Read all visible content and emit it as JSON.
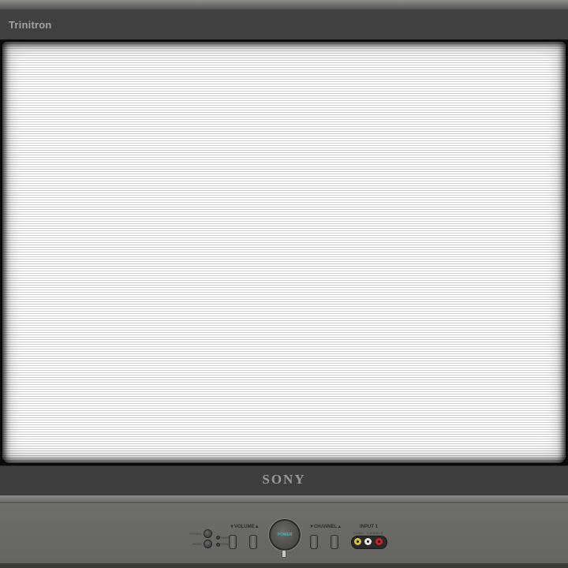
{
  "tv": {
    "brand_label": "Trinitron",
    "logo": "SONY",
    "controls": {
      "tiny_label_top": "POWER",
      "tiny_label_bottom": "MODE",
      "tiny_label_side_top": "TIMER",
      "tiny_label_side_bottom": "STANDBY",
      "volume_label": "▼VOLUME▲",
      "power_label": "POWER",
      "channel_label": "▼CHANNEL▲",
      "input_label": "INPUT 1",
      "input_sub_video": "VIDEO",
      "input_sub_audio": "L-AUDIO-R"
    },
    "colors": {
      "power_text": "#3fb6c9",
      "jack_video": "#d8c238",
      "jack_audio_left": "#e8e8e8",
      "jack_audio_right": "#c8262b"
    }
  }
}
